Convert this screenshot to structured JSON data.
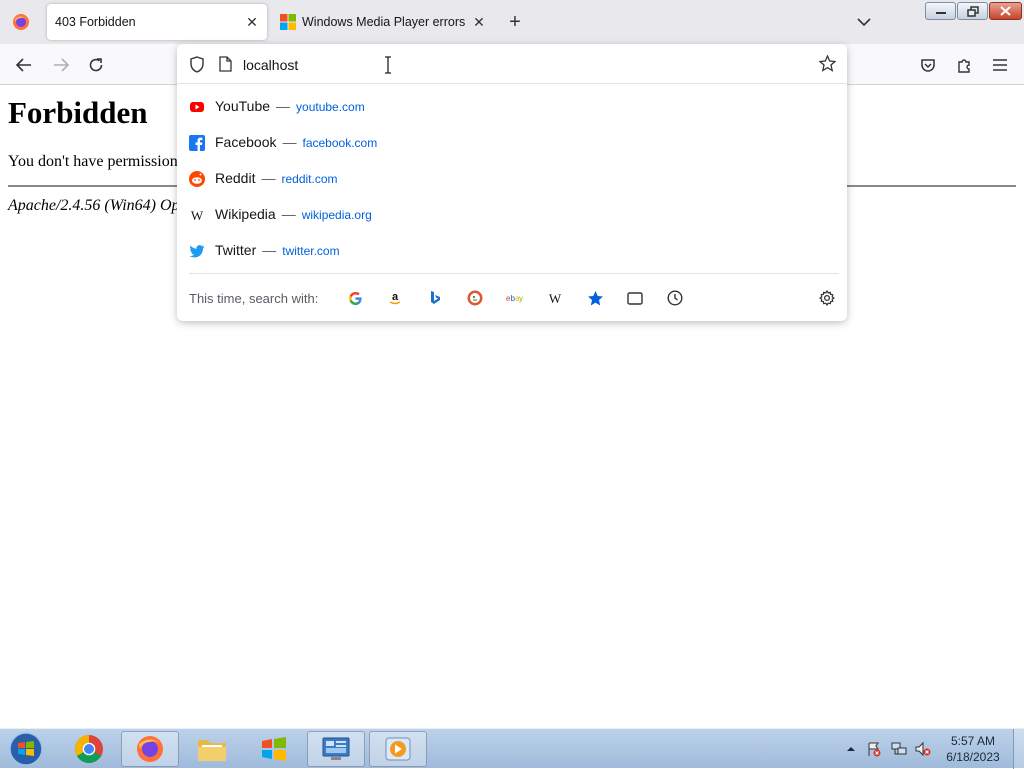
{
  "browser": {
    "tabs": [
      {
        "label": "403 Forbidden",
        "active": true
      },
      {
        "label": "Windows Media Player errors - ",
        "active": false
      }
    ],
    "address": {
      "value": "localhost"
    }
  },
  "suggestions": [
    {
      "name": "YouTube",
      "url": "youtube.com",
      "icon": "youtube-icon"
    },
    {
      "name": "Facebook",
      "url": "facebook.com",
      "icon": "facebook-icon"
    },
    {
      "name": "Reddit",
      "url": "reddit.com",
      "icon": "reddit-icon"
    },
    {
      "name": "Wikipedia",
      "url": "wikipedia.org",
      "icon": "wikipedia-icon"
    },
    {
      "name": "Twitter",
      "url": "twitter.com",
      "icon": "twitter-icon"
    }
  ],
  "search_with": {
    "label": "This time, search with:",
    "engines": [
      "google-icon",
      "amazon-icon",
      "bing-icon",
      "duckduckgo-icon",
      "ebay-icon",
      "wikipedia-icon",
      "bookmarks-icon",
      "tabs-icon",
      "history-icon"
    ]
  },
  "page": {
    "title": "Forbidden",
    "message": "You don't have permission",
    "address": "Apache/2.4.56 (Win64) Op"
  },
  "taskbar": {
    "time": "5:57 AM",
    "date": "6/18/2023"
  },
  "colors": {
    "link": "#0060df",
    "youtube": "#ff0000",
    "facebook": "#1877f2",
    "reddit": "#ff4500",
    "twitter": "#1d9bf0"
  }
}
